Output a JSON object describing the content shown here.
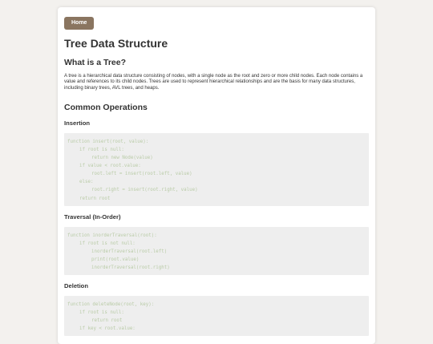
{
  "nav": {
    "home_label": "Home"
  },
  "page": {
    "title": "Tree Data Structure",
    "what_heading": "What is a Tree?",
    "intro": "A tree is a hierarchical data structure consisting of nodes, with a single node as the root and zero or more child nodes. Each node contains a value and references to its child nodes. Trees are used to represent hierarchical relationships and are the basis for many data structures, including binary trees, AVL trees, and heaps.",
    "ops_heading": "Common Operations"
  },
  "operations": [
    {
      "heading": "Insertion",
      "code": [
        "function insert(root, value):",
        "if root is null:",
        "return new Node(value)",
        "if value < root.value:",
        "root.left = insert(root.left, value)",
        "else:",
        "root.right = insert(root.right, value)",
        "return root"
      ]
    },
    {
      "heading": "Traversal (In-Order)",
      "code": [
        "function inorderTraversal(root):",
        "if root is not null:",
        "inorderTraversal(root.left)",
        "print(root.value)",
        "inorderTraversal(root.right)"
      ]
    },
    {
      "heading": "Deletion",
      "code": [
        "function deleteNode(root, key):",
        "if root is null:",
        "return root",
        "if key < root.value:"
      ]
    }
  ],
  "colors": {
    "button_bg": "#8a7560",
    "code_bg": "#eeeeee",
    "code_text": "#b9cba7",
    "page_bg": "#f3f1ee"
  }
}
